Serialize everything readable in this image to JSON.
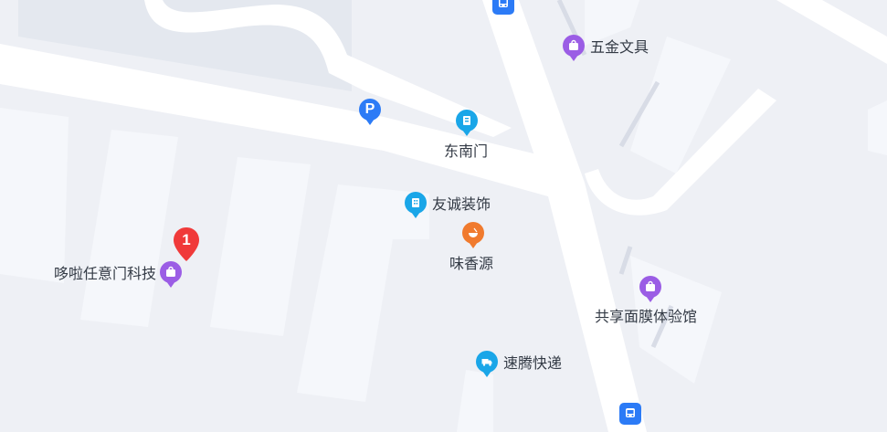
{
  "map": {
    "colors": {
      "background": "#eef0f5",
      "road": "#ffffff",
      "block": "#f5f7fb",
      "greenArea": "#e4e8ef",
      "shopPurple": "#9b5de5",
      "parkingBlue": "#2c7bf6",
      "cyanBlue": "#1aa6e8",
      "foodOrange": "#f07a2e",
      "markerRed": "#f03a3a",
      "labelText": "#333a45"
    },
    "marker": {
      "number": "1"
    },
    "pois": [
      {
        "id": "wujin",
        "label": "五金文具",
        "icon": "shopping-bag-icon"
      },
      {
        "id": "parking",
        "label": "",
        "icon": "parking-icon",
        "glyph": "P"
      },
      {
        "id": "dongnanmen",
        "label": "东南门",
        "icon": "building-entrance-icon"
      },
      {
        "id": "youcheng",
        "label": "友诚装饰",
        "icon": "building-icon"
      },
      {
        "id": "weixiangyuan",
        "label": "味香源",
        "icon": "food-bowl-icon"
      },
      {
        "id": "duola",
        "label": "哆啦任意门科技",
        "icon": "shopping-bag-icon"
      },
      {
        "id": "gongxiang",
        "label": "共享面膜体验馆",
        "icon": "shopping-bag-icon"
      },
      {
        "id": "suteng",
        "label": "速腾快递",
        "icon": "delivery-truck-icon"
      },
      {
        "id": "bus-top",
        "label": "",
        "icon": "bus-stop-icon"
      },
      {
        "id": "bus-bottom",
        "label": "",
        "icon": "bus-stop-icon"
      }
    ]
  }
}
